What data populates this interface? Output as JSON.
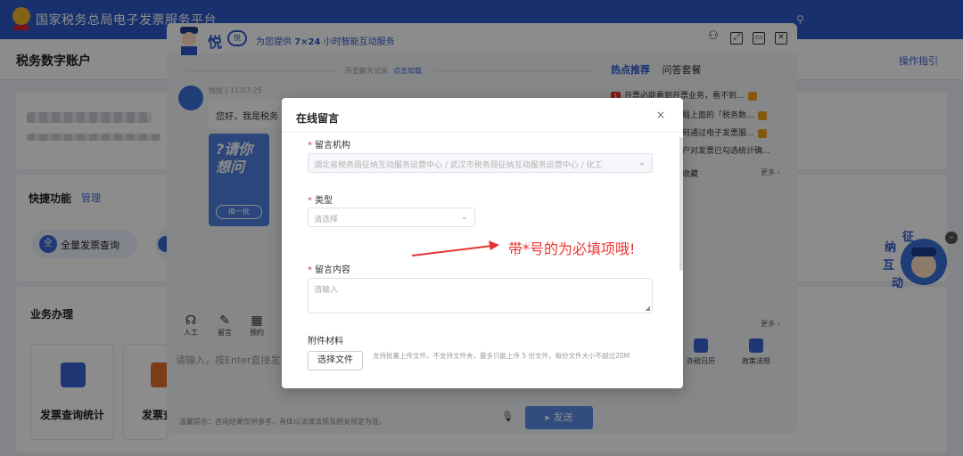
{
  "portal": {
    "title": "国家税务总局电子发票服务平台",
    "account_title": "税务数字账户",
    "guide_link": "操作指引",
    "quick_functions": "快捷功能",
    "manage": "管理",
    "quick_item": "全量发票查询",
    "business": "业务办理",
    "tile1": "发票查询统计",
    "tile2": "发票查"
  },
  "chat": {
    "brand": "悦",
    "slogan_prefix": "为您提供 ",
    "slogan_bold": "7×24",
    "slogan_suffix": " 小时智能互动服务",
    "history_label": "历史聊天记录",
    "history_link": "点击加载",
    "sender": "悦悦 | 11:07:25",
    "greeting": "您好，我是税务",
    "ask_text": "?请你想问",
    "swap_label": "换一批",
    "hot_tab": "热点推荐",
    "qa_tab": "问答套餐",
    "hot_items": [
      "开票必能看到开票业务，看不到...",
      "局上面的「税务数...",
      "何通过电子发票服...",
      "户对发票已勾选统计确...",
      "收藏"
    ],
    "more": "更多",
    "tools": [
      "人工",
      "留言",
      "预约"
    ],
    "input_placeholder": "请输入，按Enter直接发",
    "tip": "温馨提示：咨询结果仅供参考，具体以法律法规及相关规定为准。",
    "send": "发送",
    "services": [
      "办税日历",
      "政策法规"
    ]
  },
  "modal": {
    "title": "在线留言",
    "close_symbol": "×",
    "fields": {
      "org_label": "留言机构",
      "org_value": "湖北省税务局征纳互动服务运营中心 / 武汉市税务局征纳互动服务运营中心 / 化工",
      "type_label": "类型",
      "type_placeholder": "请选择",
      "content_label": "留言内容",
      "content_placeholder": "请输入",
      "attach_label": "附件材料",
      "choose_file": "选择文件",
      "upload_hint": "支持批量上传文件，不支持文件夹，最多只能上传 5 份文件，每份文件大小不超过20M"
    },
    "required_mark": "*"
  },
  "annotation": "带*号的为必填项哦!",
  "colors": {
    "brand_blue": "#2c59c9",
    "annotation_red": "#e33333"
  }
}
